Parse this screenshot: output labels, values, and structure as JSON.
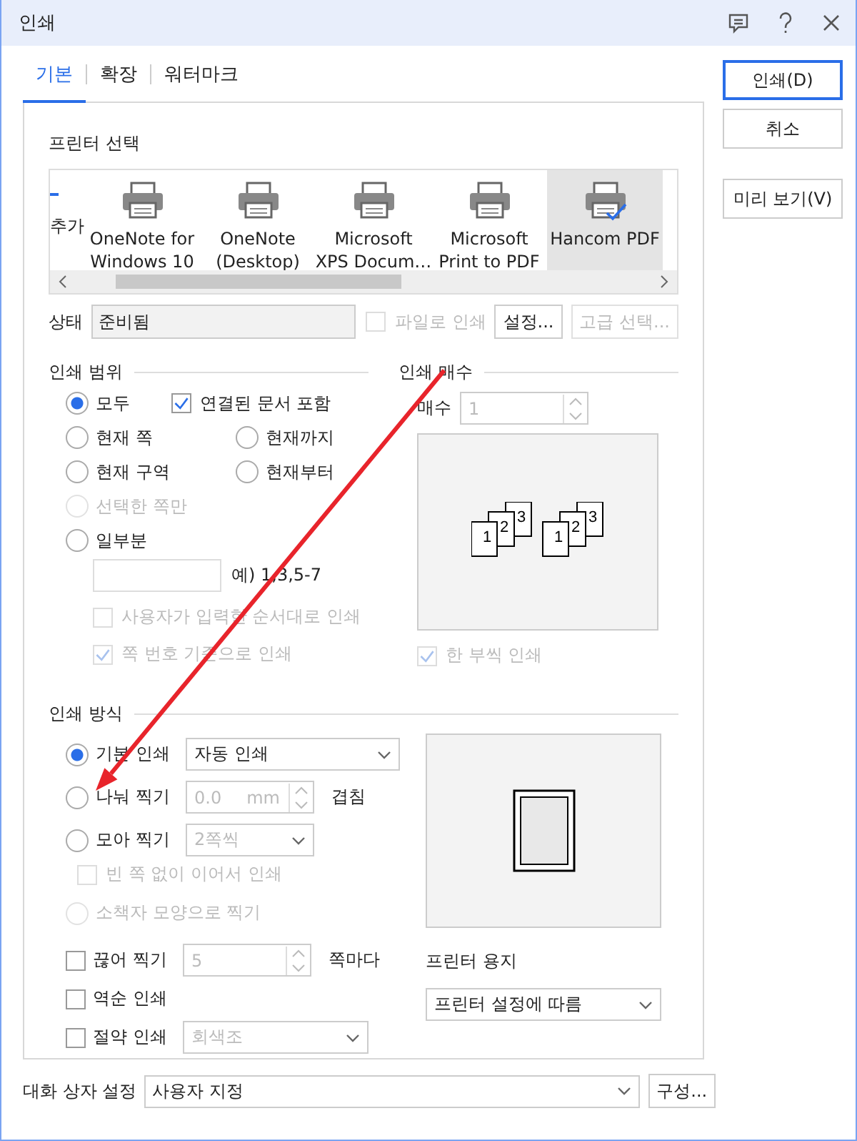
{
  "window": {
    "title": "인쇄"
  },
  "tabs": [
    {
      "label": "기본",
      "selected": true
    },
    {
      "label": "확장",
      "selected": false
    },
    {
      "label": "워터마크",
      "selected": false
    }
  ],
  "side_buttons": [
    {
      "label": "인쇄(D)",
      "kind": "default"
    },
    {
      "label": "취소",
      "kind": "normal"
    },
    {
      "label": "미리 보기(V)",
      "kind": "normal"
    }
  ],
  "printer_select": {
    "label": "프린터 선택",
    "printers": [
      {
        "name": "추가",
        "kind": "add",
        "selected": false
      },
      {
        "name": "OneNote for\nWindows 10",
        "kind": "printer",
        "selected": false
      },
      {
        "name": "OneNote\n(Desktop)",
        "kind": "printer",
        "selected": false
      },
      {
        "name": "Microsoft\nXPS Docum…",
        "kind": "printer",
        "selected": false
      },
      {
        "name": "Microsoft\nPrint to PDF",
        "kind": "printer",
        "selected": false
      },
      {
        "name": "Hancom PDF",
        "kind": "printer",
        "selected": true
      }
    ]
  },
  "status": {
    "label": "상태",
    "value": "준비됨"
  },
  "print_to_file": {
    "label": "파일로 인쇄",
    "checked": false,
    "disabled": true
  },
  "status_buttons": [
    {
      "label": "설정...",
      "disabled": false
    },
    {
      "label": "고급 선택...",
      "disabled": true
    }
  ],
  "print_range": {
    "heading": "인쇄 범위",
    "options": [
      {
        "label": "모두",
        "selected": true,
        "disabled": false
      },
      {
        "label": "현재 쪽",
        "selected": false,
        "disabled": false
      },
      {
        "label": "현재까지",
        "selected": false,
        "disabled": false
      },
      {
        "label": "현재 구역",
        "selected": false,
        "disabled": false
      },
      {
        "label": "현재부터",
        "selected": false,
        "disabled": false
      },
      {
        "label": "선택한 쪽만",
        "selected": false,
        "disabled": true
      },
      {
        "label": "일부분",
        "selected": false,
        "disabled": false
      }
    ],
    "include_linked": {
      "label": "연결된 문서 포함",
      "checked": true,
      "disabled": false
    },
    "pages_example": "예) 1,3,5-7",
    "checks": [
      {
        "label": "사용자가 입력한 순서대로 인쇄",
        "checked": false,
        "disabled": true
      },
      {
        "label": "쪽 번호 기준으로 인쇄",
        "checked": true,
        "disabled": true
      }
    ]
  },
  "copies": {
    "heading": "인쇄 매수",
    "count_label": "매수",
    "count": "1",
    "disabled": true,
    "preview_stacks": [
      [
        "1",
        "2",
        "3"
      ],
      [
        "1",
        "2",
        "3"
      ]
    ],
    "collate": {
      "label": "한 부씩 인쇄",
      "checked": true,
      "disabled": true
    }
  },
  "print_method": {
    "heading": "인쇄 방식",
    "rows": [
      {
        "kind": "radio",
        "label": "기본 인쇄",
        "selected": true,
        "disabled": false,
        "control": {
          "kind": "dropdown",
          "value": "자동 인쇄",
          "disabled": false
        }
      },
      {
        "kind": "radio",
        "label": "나눠 찍기",
        "selected": false,
        "disabled": false,
        "control": {
          "kind": "spin",
          "value": "0.0",
          "unit": "mm",
          "disabled": true
        },
        "suffix": "겹침"
      },
      {
        "kind": "radio",
        "label": "모아 찍기",
        "selected": false,
        "disabled": false,
        "control": {
          "kind": "dropdown",
          "value": "2쪽씩",
          "disabled": true
        },
        "children": [
          {
            "kind": "checkbox",
            "label": "빈 쪽 없이 이어서 인쇄",
            "checked": false,
            "disabled": true
          }
        ]
      },
      {
        "kind": "radio",
        "label": "소책자 모양으로 찍기",
        "selected": false,
        "disabled": true
      }
    ]
  },
  "options": [
    {
      "label": "끊어 찍기",
      "checked": false,
      "disabled": false,
      "control": {
        "kind": "spin",
        "value": "5",
        "disabled": true
      },
      "suffix": "쪽마다"
    },
    {
      "label": "역순 인쇄",
      "checked": false,
      "disabled": false
    },
    {
      "label": "절약 인쇄",
      "checked": false,
      "disabled": false,
      "control": {
        "kind": "dropdown",
        "value": "회색조",
        "disabled": true
      }
    }
  ],
  "paper": {
    "label": "프린터 용지",
    "value": "프린터 설정에 따름"
  },
  "dialog_settings": {
    "label": "대화 상자 설정",
    "value": "사용자 지정",
    "button": "구성..."
  }
}
